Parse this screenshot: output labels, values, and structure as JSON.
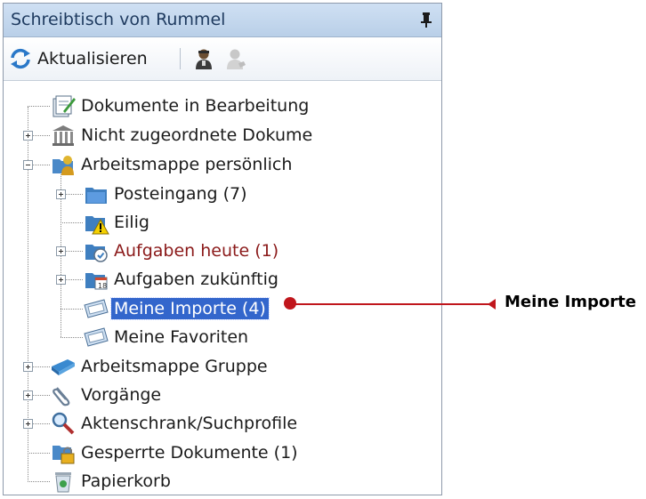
{
  "panel": {
    "title": "Schreibtisch von Rummel",
    "pin_icon": "pin-icon"
  },
  "toolbar": {
    "refresh_label": "Aktualisieren",
    "refresh_icon": "refresh-icon",
    "user_icon": "user-icon",
    "user_disabled_icon": "user-disabled-icon"
  },
  "tree": {
    "items": [
      {
        "label": "Dokumente in Bearbeitung",
        "icon": "documents-edit-icon"
      },
      {
        "label": "Nicht zugeordnete Dokume",
        "icon": "unassigned-documents-icon"
      },
      {
        "label": "Arbeitsmappe persönlich",
        "icon": "personal-folder-icon"
      },
      {
        "label": "Posteingang (7)",
        "icon": "inbox-folder-icon"
      },
      {
        "label": "Eilig",
        "icon": "urgent-folder-icon"
      },
      {
        "label": "Aufgaben heute (1)",
        "icon": "tasks-today-icon"
      },
      {
        "label": "Aufgaben zukünftig",
        "icon": "tasks-future-icon"
      },
      {
        "label": "Meine Importe (4)",
        "icon": "imports-icon"
      },
      {
        "label": "Meine Favoriten",
        "icon": "favorites-icon"
      },
      {
        "label": "Arbeitsmappe Gruppe",
        "icon": "group-folder-icon"
      },
      {
        "label": "Vorgänge",
        "icon": "paperclip-icon"
      },
      {
        "label": "Aktenschrank/Suchprofile",
        "icon": "search-icon"
      },
      {
        "label": "Gesperrte Dokumente (1)",
        "icon": "locked-documents-icon"
      },
      {
        "label": "Papierkorb",
        "icon": "recycle-bin-icon"
      }
    ]
  },
  "callout": {
    "label": "Meine Importe"
  },
  "colors": {
    "selection": "#3366cc",
    "highlight_text": "#8b1a1a",
    "callout": "#c0161c",
    "titlebar": "#c4d8ef"
  }
}
